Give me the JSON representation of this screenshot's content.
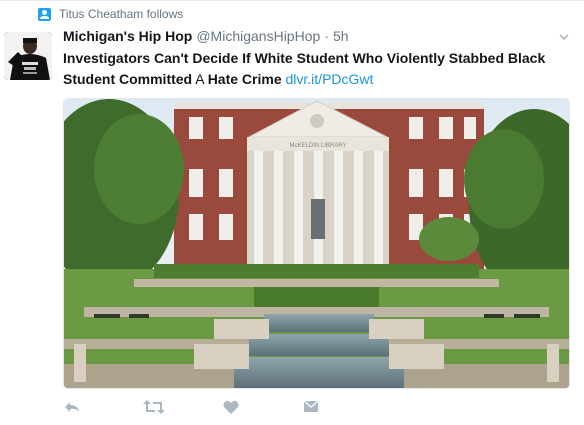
{
  "context": {
    "text": "Titus Cheatham follows"
  },
  "tweet": {
    "display_name": "Michigan's Hip Hop",
    "handle": "@MichigansHipHop",
    "separator": "·",
    "time": "5h",
    "text": {
      "part1": "Investigators Can't Decide If White Student Who Violently Stabbed Black Student Committed",
      "part2": " A ",
      "part3": "Hate Crime",
      "link": "dlvr.it/PDcGwt"
    },
    "media": {
      "building_sign": "McKELDIN LIBRARY"
    }
  },
  "actions": [
    "reply-icon",
    "retweet-icon",
    "like-icon",
    "direct-message-icon"
  ],
  "colors": {
    "link": "#1b95e0",
    "muted": "#657786",
    "icon": "#aab8c2",
    "accent": "#1da1f2"
  }
}
